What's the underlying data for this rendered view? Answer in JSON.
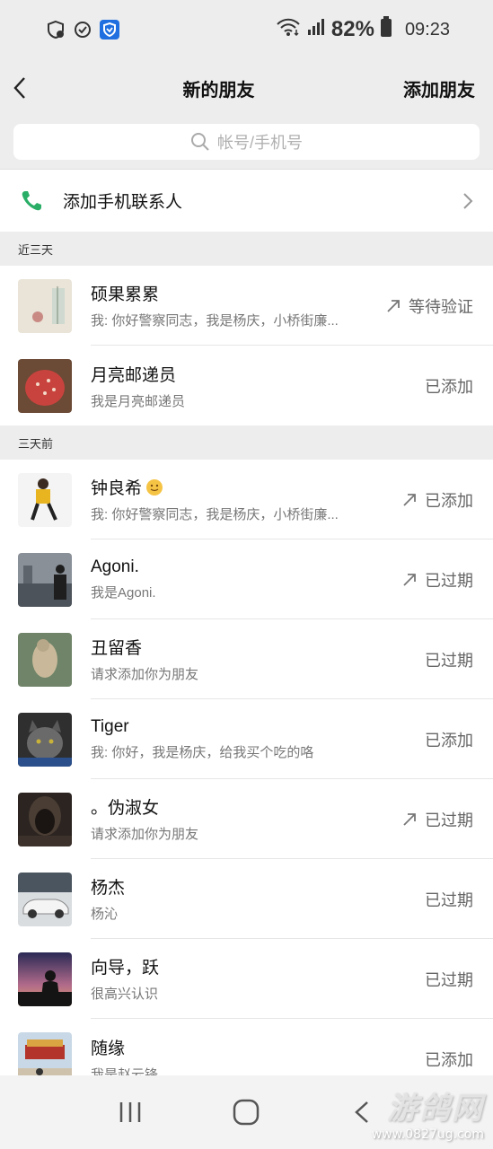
{
  "status_bar": {
    "battery_percent": "82%",
    "time": "09:23",
    "icons": [
      "shield-check-icon",
      "vpn-icon",
      "security-app-icon",
      "wifi-icon",
      "signal-icon",
      "battery-icon"
    ]
  },
  "header": {
    "title": "新的朋友",
    "add_friend": "添加朋友",
    "back_icon": "chevron-left-icon"
  },
  "search": {
    "placeholder": "帐号/手机号"
  },
  "phone_contacts": {
    "label": "添加手机联系人",
    "icon": "phone-icon",
    "icon_color": "#2aae67"
  },
  "sections": [
    {
      "title": "近三天",
      "items": [
        {
          "name": "硕果累累",
          "msg": "我: 你好警察同志，我是杨庆，小桥街廉...",
          "status": "等待验证",
          "arrow": true
        },
        {
          "name": "月亮邮递员",
          "msg": "我是月亮邮递员",
          "status": "已添加",
          "arrow": false
        }
      ]
    },
    {
      "title": "三天前",
      "items": [
        {
          "name": "钟良希",
          "msg": "我: 你好警察同志，我是杨庆，小桥街廉...",
          "status": "已添加",
          "arrow": true,
          "emoji": true
        },
        {
          "name": "Agoni.",
          "msg": "我是Agoni.",
          "status": "已过期",
          "arrow": true
        },
        {
          "name": "丑留香",
          "msg": "请求添加你为朋友",
          "status": "已过期",
          "arrow": false
        },
        {
          "name": "Tiger",
          "msg": "我: 你好，我是杨庆，给我买个吃的咯",
          "status": "已添加",
          "arrow": false
        },
        {
          "name": "。伪淑女",
          "msg": "请求添加你为朋友",
          "status": "已过期",
          "arrow": true
        },
        {
          "name": "杨杰",
          "msg": "杨沁",
          "status": "已过期",
          "arrow": false
        },
        {
          "name": "向导，跃",
          "msg": "很高兴认识",
          "status": "已过期",
          "arrow": false
        },
        {
          "name": "随缘",
          "msg": "我是赵云锋",
          "status": "已添加",
          "arrow": false
        }
      ]
    }
  ],
  "nav": {
    "buttons": [
      "recent-apps-icon",
      "home-icon",
      "back-icon"
    ]
  },
  "watermark": {
    "big": "游鸽网",
    "small": "www.0827ug.com"
  },
  "avatar_colors": [
    "#e9e4d7",
    "#8a3b2e",
    "#f2f2f2",
    "#6e7780",
    "#7a8e72",
    "#3b3b3b",
    "#4a3b32",
    "#c9c9c9",
    "#3a2a3a",
    "#c7a98f"
  ]
}
